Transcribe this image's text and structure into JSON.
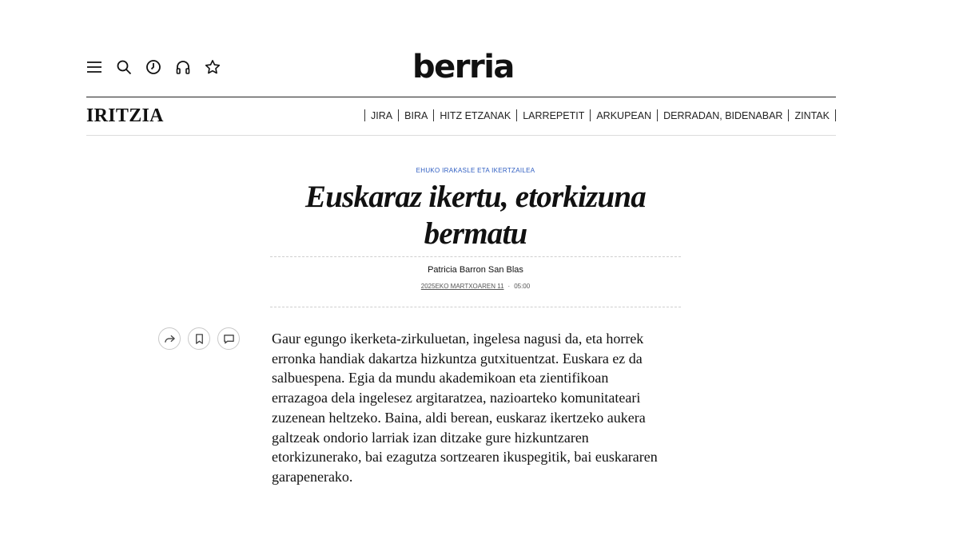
{
  "toolbar": {
    "icons": [
      "menu-icon",
      "search-icon",
      "clock-icon",
      "headphones-icon",
      "star-icon"
    ]
  },
  "brand": {
    "logo": "berria"
  },
  "section": {
    "title": "IRITZIA",
    "nav": [
      "JIRA",
      "BIRA",
      "HITZ ETZANAK",
      "LARREPETIT",
      "ARKUPEAN",
      "DERRADAN, BIDENABAR",
      "ZINTAK"
    ]
  },
  "article": {
    "kicker": "EHUKO IRAKASLE ETA IKERTZAILEA",
    "headline_line1": "Euskaraz ikertu, etorkizuna",
    "headline_line2": "bermatu",
    "author": "Patricia Barron San Blas",
    "date": "2025EKO MARTXOAREN 11",
    "separator": "·",
    "time": "05:00",
    "body_lines": [
      "Gaur egungo ikerketa-zirkuluetan, ingelesa nagusi da, eta horrek",
      "erronka handiak dakartza hizkuntza gutxituentzat. Euskara ez da",
      "salbuespena. Egia da mundu akademikoan eta zientifikoan",
      "errazagoa dela ingelesez argitaratzea, nazioarteko komunitateari",
      "zuzenean heltzeko. Baina, aldi berean, euskaraz ikertzeko aukera",
      "galtzeak ondorio larriak izan ditzake gure hizkuntzaren",
      "etorkizunerako, bai ezagutza sortzearen ikuspegitik, bai euskararen",
      "garapenerako."
    ]
  },
  "share": {
    "icons": [
      "share-icon",
      "bookmark-icon",
      "comment-icon"
    ]
  },
  "colors": {
    "accent": "#2f5ec2",
    "text": "#111111",
    "rule": "#222222"
  }
}
